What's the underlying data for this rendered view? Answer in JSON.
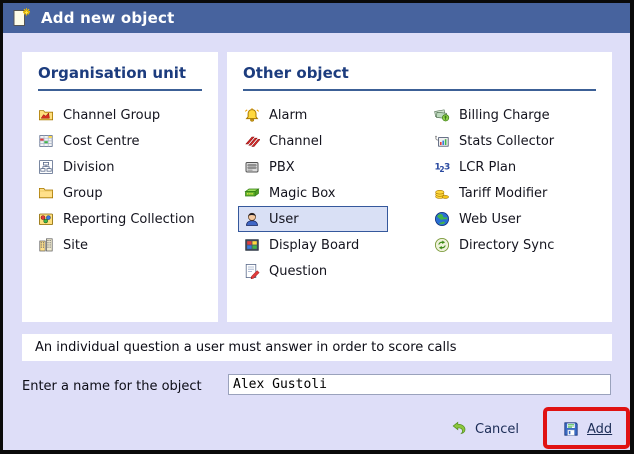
{
  "window": {
    "title": "Add new object",
    "icon": "new-object-icon"
  },
  "panels": {
    "organisation": {
      "heading": "Organisation unit",
      "items": [
        {
          "label": "Channel Group",
          "icon": "folder-chart-icon"
        },
        {
          "label": "Cost Centre",
          "icon": "cost-grid-icon"
        },
        {
          "label": "Division",
          "icon": "org-chart-icon"
        },
        {
          "label": "Group",
          "icon": "folder-icon"
        },
        {
          "label": "Reporting Collection",
          "icon": "collection-icon"
        },
        {
          "label": "Site",
          "icon": "buildings-icon"
        }
      ]
    },
    "other": {
      "heading": "Other object",
      "col1": [
        {
          "label": "Alarm",
          "icon": "bell-icon"
        },
        {
          "label": "Channel",
          "icon": "channel-stripes-icon"
        },
        {
          "label": "PBX",
          "icon": "pbx-icon"
        },
        {
          "label": "Magic Box",
          "icon": "magic-box-icon"
        },
        {
          "label": "User",
          "icon": "user-icon",
          "selected": true
        },
        {
          "label": "Display Board",
          "icon": "display-board-icon"
        },
        {
          "label": "Question",
          "icon": "question-pencil-icon"
        }
      ],
      "col2": [
        {
          "label": "Billing Charge",
          "icon": "billing-icon"
        },
        {
          "label": "Stats Collector",
          "icon": "stats-icon"
        },
        {
          "label": "LCR Plan",
          "icon": "numbers-123-icon"
        },
        {
          "label": "Tariff Modifier",
          "icon": "coins-icon"
        },
        {
          "label": "Web User",
          "icon": "globe-icon"
        },
        {
          "label": "Directory Sync",
          "icon": "sync-icon"
        }
      ]
    }
  },
  "description": "An individual question a user must answer in order to score calls",
  "name_prompt": {
    "label": "Enter a name for the object",
    "value": "Alex Gustoli"
  },
  "actions": {
    "cancel": {
      "label": "Cancel",
      "icon": "undo-icon"
    },
    "add": {
      "label": "Add",
      "icon": "save-icon",
      "highlighted": true
    }
  },
  "colors": {
    "title_bar": "#47639e",
    "dialog_bg": "#dedef8",
    "heading": "#1c3c7e",
    "selection_bg": "#d9e0f5",
    "selection_border": "#35589c",
    "annotation": "#e01212"
  }
}
